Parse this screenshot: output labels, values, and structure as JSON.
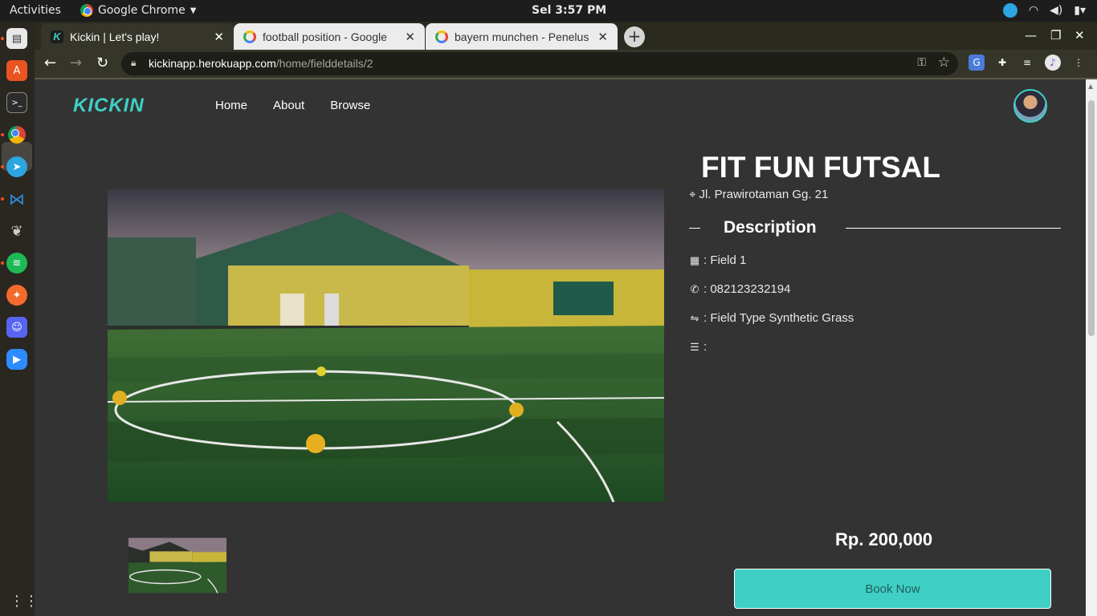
{
  "system": {
    "activities": "Activities",
    "app_name": "Google Chrome",
    "clock": "Sel  3:57 PM"
  },
  "browser": {
    "tabs": [
      {
        "title": "Kickin | Let's play!",
        "active": true
      },
      {
        "title": "football position - Google",
        "active": false
      },
      {
        "title": "bayern munchen - Penelus",
        "active": false
      }
    ],
    "url_host": "kickinapp.herokuapp.com",
    "url_path": "/home/fielddetails/2"
  },
  "site": {
    "logo": "KICKIN",
    "nav": [
      "Home",
      "About",
      "Browse"
    ]
  },
  "field": {
    "name": "FIT FUN FUTSAL",
    "address": "Jl. Prawirotaman Gg. 21",
    "description_heading": "Description",
    "details": [
      {
        "icon": "grid-icon",
        "text": ": Field 1"
      },
      {
        "icon": "phone-icon",
        "text": ": 082123232194"
      },
      {
        "icon": "exchange-icon",
        "text": ": Field Type Synthetic Grass"
      },
      {
        "icon": "list-icon",
        "text": ":"
      }
    ],
    "price": "Rp. 200,000",
    "book_label": "Book Now"
  },
  "colors": {
    "accent": "#40cfc5",
    "page_bg": "#333333"
  }
}
